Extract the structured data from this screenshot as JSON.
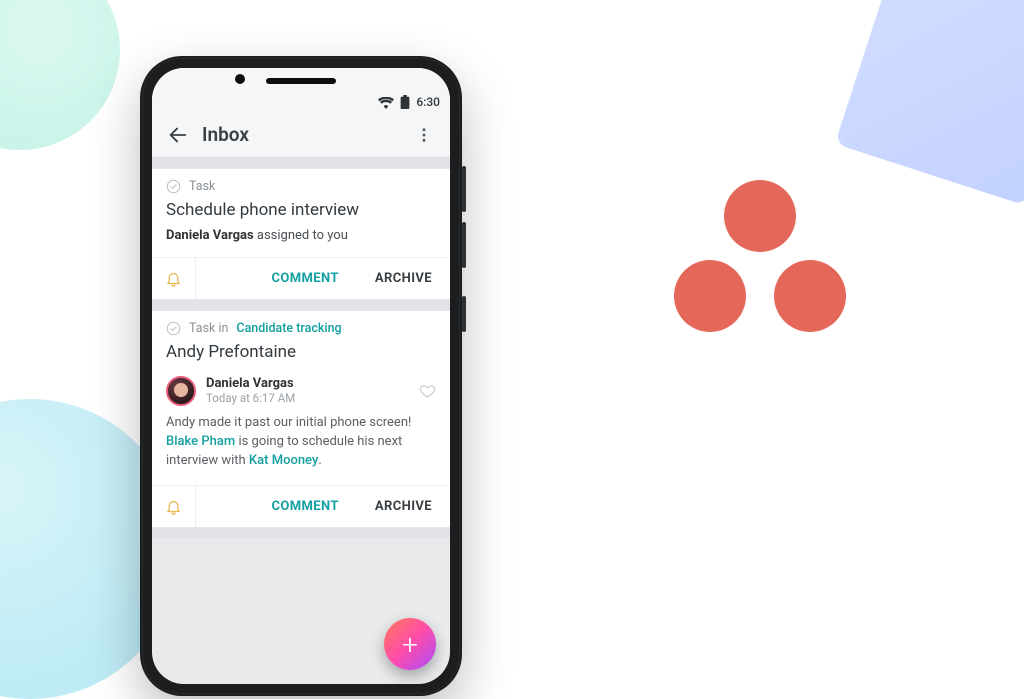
{
  "status_bar": {
    "time": "6:30"
  },
  "header": {
    "title": "Inbox"
  },
  "card1": {
    "type_label": "Task",
    "title": "Schedule phone interview",
    "actor": "Daniela Vargas",
    "action_text": " assigned to you",
    "comment_label": "COMMENT",
    "archive_label": "ARCHIVE"
  },
  "card2": {
    "type_prefix": "Task in ",
    "project_link": "Candidate tracking",
    "title": "Andy Prefontaine",
    "comment": {
      "author": "Daniela Vargas",
      "timestamp": "Today at 6:17 AM",
      "body_parts": {
        "p1": "Andy made it past our initial phone screen! ",
        "m1": "Blake Pham",
        "p2": " is going to schedule his next interview with ",
        "m2": "Kat Mooney",
        "p3": "."
      }
    },
    "comment_label": "COMMENT",
    "archive_label": "ARCHIVE"
  }
}
